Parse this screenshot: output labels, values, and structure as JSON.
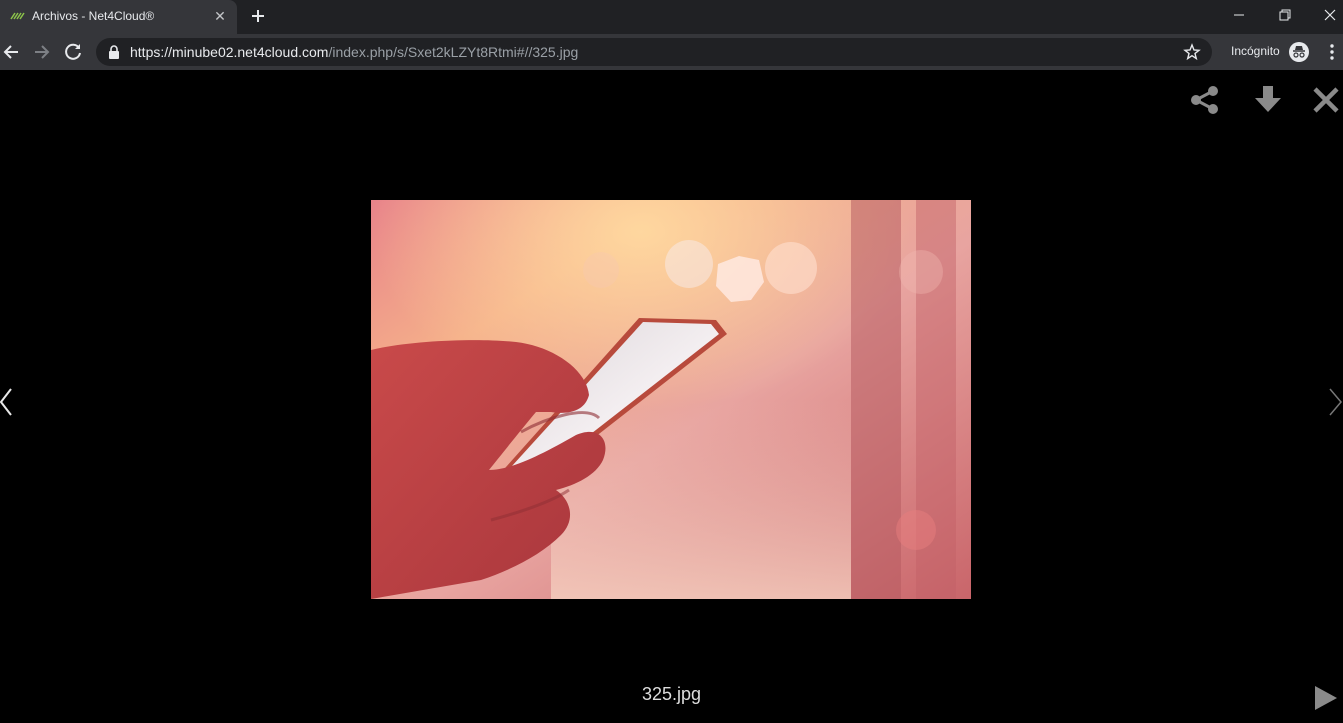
{
  "tab": {
    "title": "Archivos - Net4Cloud®",
    "close_symbol": "✕"
  },
  "omnibox": {
    "url_host_part": "https://minube02.net4cloud.com",
    "url_path_part": "/index.php/s/Sxet2kLZYt8Rtmi#//325.jpg"
  },
  "profile": {
    "label": "Incógnito"
  },
  "viewer": {
    "filename": "325.jpg"
  },
  "colors": {
    "chrome_dark": "#202124",
    "chrome_toolbar": "#35363a",
    "viewer_bg": "#000000",
    "icon_grey": "#8a8a8a"
  }
}
